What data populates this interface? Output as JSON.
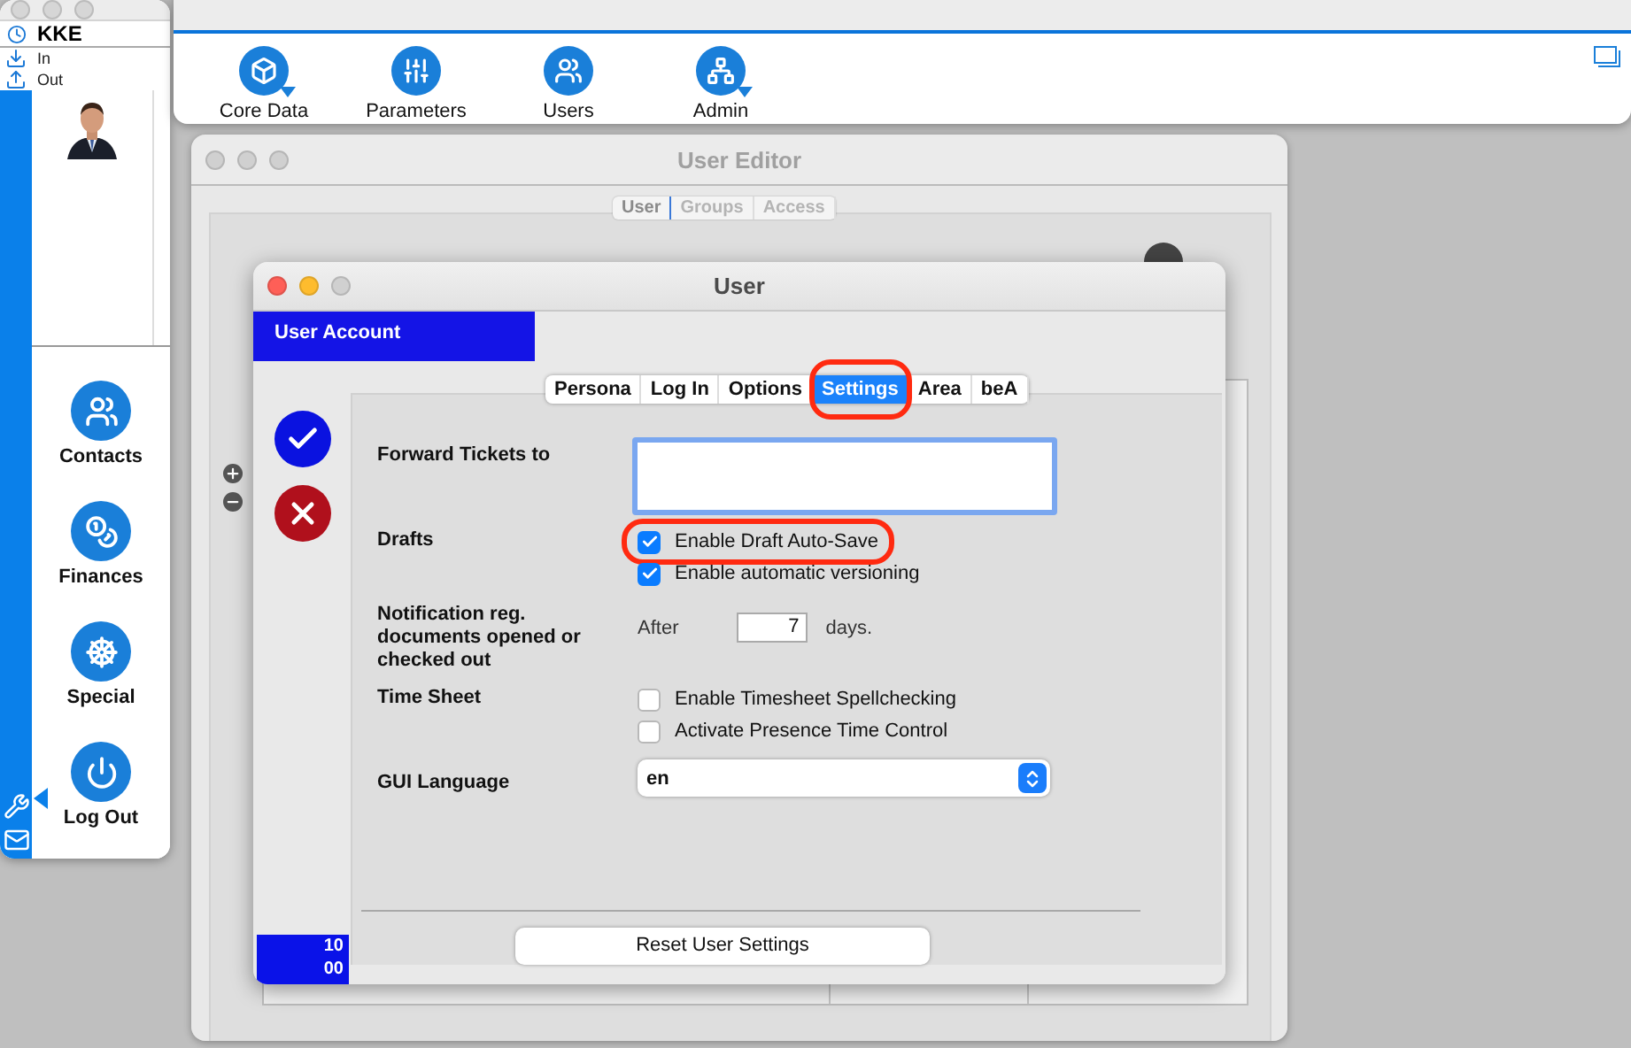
{
  "side_window": {
    "user": "KKE",
    "status_items": [
      {
        "label": "In",
        "kind": "in"
      },
      {
        "label": "Out",
        "kind": "out"
      }
    ],
    "nav": [
      {
        "label": "Contacts",
        "kind": "contacts"
      },
      {
        "label": "Finances",
        "kind": "finances"
      },
      {
        "label": "Special",
        "kind": "special"
      },
      {
        "label": "Log Out",
        "kind": "logout"
      }
    ]
  },
  "toolbar": {
    "items": [
      {
        "label": "Core Data",
        "kind": "cube",
        "has_menu": true
      },
      {
        "label": "Parameters",
        "kind": "sliders",
        "has_menu": false
      },
      {
        "label": "Users",
        "kind": "users",
        "has_menu": false
      },
      {
        "label": "Admin",
        "kind": "network",
        "has_menu": true
      }
    ]
  },
  "editor": {
    "title": "User Editor",
    "tabs": [
      {
        "label": "User",
        "selected": true
      },
      {
        "label": "Groups",
        "selected": false
      },
      {
        "label": "Access",
        "selected": false
      }
    ]
  },
  "dialog": {
    "title": "User",
    "header": "User Account",
    "footer_lines": [
      "10",
      "00"
    ],
    "tabs": [
      {
        "label": "Persona",
        "selected": false,
        "highlighted": false
      },
      {
        "label": "Log In",
        "selected": false,
        "highlighted": false
      },
      {
        "label": "Options",
        "selected": false,
        "highlighted": false
      },
      {
        "label": "Settings",
        "selected": true,
        "highlighted": true
      },
      {
        "label": "Area",
        "selected": false,
        "highlighted": false
      },
      {
        "label": "beA",
        "selected": false,
        "highlighted": false
      }
    ],
    "form": [
      {
        "label": "Forward Tickets to",
        "kind": "textarea"
      },
      {
        "label": "Drafts",
        "kind": "checks",
        "options": [
          {
            "label": "Enable Draft Auto-Save",
            "checked": true,
            "highlighted": true
          },
          {
            "label": "Enable automatic versioning",
            "checked": true,
            "highlighted": false
          }
        ]
      },
      {
        "label": "Notification reg. documents opened or checked out",
        "kind": "number",
        "prefix": "After",
        "value": "7",
        "suffix": "days."
      },
      {
        "label": "Time Sheet",
        "kind": "checks",
        "options": [
          {
            "label": "Enable Timesheet Spellchecking",
            "checked": false,
            "highlighted": false
          },
          {
            "label": "Activate Presence Time Control",
            "checked": false,
            "highlighted": false
          }
        ]
      },
      {
        "label": "GUI Language",
        "kind": "select",
        "value": "en"
      }
    ],
    "reset_button": "Reset User Settings"
  }
}
